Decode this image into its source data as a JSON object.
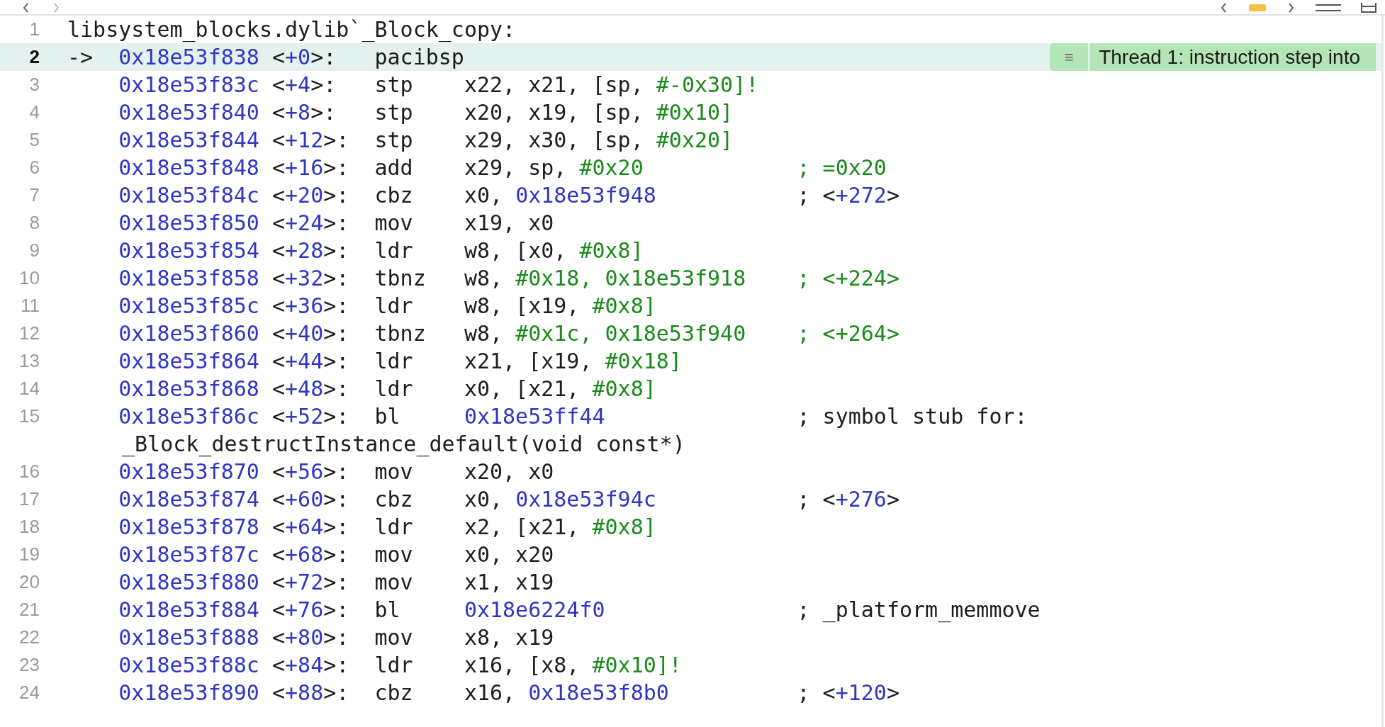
{
  "editor": {
    "rows": [
      {
        "number": "1",
        "kind": "label",
        "current": false,
        "label": "libsystem_blocks.dylib`_Block_copy:"
      },
      {
        "number": "2",
        "kind": "instruction",
        "current": true,
        "marker": "->",
        "address": "0x18e53f838",
        "offset": [
          {
            "text": "<",
            "kind": "plain"
          },
          {
            "text": "+0",
            "kind": "addr"
          },
          {
            "text": ">:",
            "kind": "plain"
          }
        ],
        "mnemonic": "pacibsp",
        "operands": [],
        "comment": [],
        "annotation": {
          "icon": "≡",
          "text": "Thread 1: instruction step into"
        }
      },
      {
        "number": "3",
        "kind": "instruction",
        "current": false,
        "address": "0x18e53f83c",
        "offset": [
          {
            "text": "<",
            "kind": "plain"
          },
          {
            "text": "+4",
            "kind": "addr"
          },
          {
            "text": ">:",
            "kind": "plain"
          }
        ],
        "mnemonic": "stp",
        "operands": [
          {
            "text": "x22, x21, [sp, ",
            "kind": "plain"
          },
          {
            "text": "#-0x30]!",
            "kind": "imm"
          }
        ],
        "comment": []
      },
      {
        "number": "4",
        "kind": "instruction",
        "current": false,
        "address": "0x18e53f840",
        "offset": [
          {
            "text": "<",
            "kind": "plain"
          },
          {
            "text": "+8",
            "kind": "addr"
          },
          {
            "text": ">:",
            "kind": "plain"
          }
        ],
        "mnemonic": "stp",
        "operands": [
          {
            "text": "x20, x19, [sp, ",
            "kind": "plain"
          },
          {
            "text": "#0x10]",
            "kind": "imm"
          }
        ],
        "comment": []
      },
      {
        "number": "5",
        "kind": "instruction",
        "current": false,
        "address": "0x18e53f844",
        "offset": [
          {
            "text": "<",
            "kind": "plain"
          },
          {
            "text": "+12",
            "kind": "addr"
          },
          {
            "text": ">:",
            "kind": "plain"
          }
        ],
        "mnemonic": "stp",
        "operands": [
          {
            "text": "x29, x30, [sp, ",
            "kind": "plain"
          },
          {
            "text": "#0x20]",
            "kind": "imm"
          }
        ],
        "comment": []
      },
      {
        "number": "6",
        "kind": "instruction",
        "current": false,
        "address": "0x18e53f848",
        "offset": [
          {
            "text": "<",
            "kind": "plain"
          },
          {
            "text": "+16",
            "kind": "addr"
          },
          {
            "text": ">:",
            "kind": "plain"
          }
        ],
        "mnemonic": "add",
        "operands": [
          {
            "text": "x29, sp, ",
            "kind": "plain"
          },
          {
            "text": "#0x20",
            "kind": "imm"
          }
        ],
        "comment": [
          {
            "text": "; =0x20",
            "kind": "imm"
          }
        ]
      },
      {
        "number": "7",
        "kind": "instruction",
        "current": false,
        "address": "0x18e53f84c",
        "offset": [
          {
            "text": "<",
            "kind": "plain"
          },
          {
            "text": "+20",
            "kind": "addr"
          },
          {
            "text": ">:",
            "kind": "plain"
          }
        ],
        "mnemonic": "cbz",
        "operands": [
          {
            "text": "x0, ",
            "kind": "plain"
          },
          {
            "text": "0x18e53f948",
            "kind": "addr"
          }
        ],
        "comment": [
          {
            "text": "; <",
            "kind": "plain"
          },
          {
            "text": "+272",
            "kind": "addr"
          },
          {
            "text": ">",
            "kind": "plain"
          }
        ]
      },
      {
        "number": "8",
        "kind": "instruction",
        "current": false,
        "address": "0x18e53f850",
        "offset": [
          {
            "text": "<",
            "kind": "plain"
          },
          {
            "text": "+24",
            "kind": "addr"
          },
          {
            "text": ">:",
            "kind": "plain"
          }
        ],
        "mnemonic": "mov",
        "operands": [
          {
            "text": "x19, x0",
            "kind": "plain"
          }
        ],
        "comment": []
      },
      {
        "number": "9",
        "kind": "instruction",
        "current": false,
        "address": "0x18e53f854",
        "offset": [
          {
            "text": "<",
            "kind": "plain"
          },
          {
            "text": "+28",
            "kind": "addr"
          },
          {
            "text": ">:",
            "kind": "plain"
          }
        ],
        "mnemonic": "ldr",
        "operands": [
          {
            "text": "w8, [x0, ",
            "kind": "plain"
          },
          {
            "text": "#0x8]",
            "kind": "imm"
          }
        ],
        "comment": []
      },
      {
        "number": "10",
        "kind": "instruction",
        "current": false,
        "address": "0x18e53f858",
        "offset": [
          {
            "text": "<",
            "kind": "plain"
          },
          {
            "text": "+32",
            "kind": "addr"
          },
          {
            "text": ">:",
            "kind": "plain"
          }
        ],
        "mnemonic": "tbnz",
        "operands": [
          {
            "text": "w8, ",
            "kind": "plain"
          },
          {
            "text": "#0x18, 0x18e53f918",
            "kind": "imm"
          }
        ],
        "comment": [
          {
            "text": "; <+224>",
            "kind": "imm"
          }
        ]
      },
      {
        "number": "11",
        "kind": "instruction",
        "current": false,
        "address": "0x18e53f85c",
        "offset": [
          {
            "text": "<",
            "kind": "plain"
          },
          {
            "text": "+36",
            "kind": "addr"
          },
          {
            "text": ">:",
            "kind": "plain"
          }
        ],
        "mnemonic": "ldr",
        "operands": [
          {
            "text": "w8, [x19, ",
            "kind": "plain"
          },
          {
            "text": "#0x8]",
            "kind": "imm"
          }
        ],
        "comment": []
      },
      {
        "number": "12",
        "kind": "instruction",
        "current": false,
        "address": "0x18e53f860",
        "offset": [
          {
            "text": "<",
            "kind": "plain"
          },
          {
            "text": "+40",
            "kind": "addr"
          },
          {
            "text": ">:",
            "kind": "plain"
          }
        ],
        "mnemonic": "tbnz",
        "operands": [
          {
            "text": "w8, ",
            "kind": "plain"
          },
          {
            "text": "#0x1c, 0x18e53f940",
            "kind": "imm"
          }
        ],
        "comment": [
          {
            "text": "; <+264>",
            "kind": "imm"
          }
        ]
      },
      {
        "number": "13",
        "kind": "instruction",
        "current": false,
        "address": "0x18e53f864",
        "offset": [
          {
            "text": "<",
            "kind": "plain"
          },
          {
            "text": "+44",
            "kind": "addr"
          },
          {
            "text": ">:",
            "kind": "plain"
          }
        ],
        "mnemonic": "ldr",
        "operands": [
          {
            "text": "x21, [x19, ",
            "kind": "plain"
          },
          {
            "text": "#0x18]",
            "kind": "imm"
          }
        ],
        "comment": []
      },
      {
        "number": "14",
        "kind": "instruction",
        "current": false,
        "address": "0x18e53f868",
        "offset": [
          {
            "text": "<",
            "kind": "plain"
          },
          {
            "text": "+48",
            "kind": "addr"
          },
          {
            "text": ">:",
            "kind": "plain"
          }
        ],
        "mnemonic": "ldr",
        "operands": [
          {
            "text": "x0, [x21, ",
            "kind": "plain"
          },
          {
            "text": "#0x8]",
            "kind": "imm"
          }
        ],
        "comment": []
      },
      {
        "number": "15",
        "kind": "instruction",
        "current": false,
        "address": "0x18e53f86c",
        "offset": [
          {
            "text": "<",
            "kind": "plain"
          },
          {
            "text": "+52",
            "kind": "addr"
          },
          {
            "text": ">:",
            "kind": "plain"
          }
        ],
        "mnemonic": "bl",
        "operands": [
          {
            "text": "0x18e53ff44",
            "kind": "addr"
          }
        ],
        "comment": [
          {
            "text": "; symbol stub for:",
            "kind": "plain"
          }
        ],
        "continuation": "_Block_destructInstance_default(void const*)"
      },
      {
        "number": "16",
        "kind": "instruction",
        "current": false,
        "address": "0x18e53f870",
        "offset": [
          {
            "text": "<",
            "kind": "plain"
          },
          {
            "text": "+56",
            "kind": "addr"
          },
          {
            "text": ">:",
            "kind": "plain"
          }
        ],
        "mnemonic": "mov",
        "operands": [
          {
            "text": "x20, x0",
            "kind": "plain"
          }
        ],
        "comment": []
      },
      {
        "number": "17",
        "kind": "instruction",
        "current": false,
        "address": "0x18e53f874",
        "offset": [
          {
            "text": "<",
            "kind": "plain"
          },
          {
            "text": "+60",
            "kind": "addr"
          },
          {
            "text": ">:",
            "kind": "plain"
          }
        ],
        "mnemonic": "cbz",
        "operands": [
          {
            "text": "x0, ",
            "kind": "plain"
          },
          {
            "text": "0x18e53f94c",
            "kind": "addr"
          }
        ],
        "comment": [
          {
            "text": "; <",
            "kind": "plain"
          },
          {
            "text": "+276",
            "kind": "addr"
          },
          {
            "text": ">",
            "kind": "plain"
          }
        ]
      },
      {
        "number": "18",
        "kind": "instruction",
        "current": false,
        "address": "0x18e53f878",
        "offset": [
          {
            "text": "<",
            "kind": "plain"
          },
          {
            "text": "+64",
            "kind": "addr"
          },
          {
            "text": ">:",
            "kind": "plain"
          }
        ],
        "mnemonic": "ldr",
        "operands": [
          {
            "text": "x2, [x21, ",
            "kind": "plain"
          },
          {
            "text": "#0x8]",
            "kind": "imm"
          }
        ],
        "comment": []
      },
      {
        "number": "19",
        "kind": "instruction",
        "current": false,
        "address": "0x18e53f87c",
        "offset": [
          {
            "text": "<",
            "kind": "plain"
          },
          {
            "text": "+68",
            "kind": "addr"
          },
          {
            "text": ">:",
            "kind": "plain"
          }
        ],
        "mnemonic": "mov",
        "operands": [
          {
            "text": "x0, x20",
            "kind": "plain"
          }
        ],
        "comment": []
      },
      {
        "number": "20",
        "kind": "instruction",
        "current": false,
        "address": "0x18e53f880",
        "offset": [
          {
            "text": "<",
            "kind": "plain"
          },
          {
            "text": "+72",
            "kind": "addr"
          },
          {
            "text": ">:",
            "kind": "plain"
          }
        ],
        "mnemonic": "mov",
        "operands": [
          {
            "text": "x1, x19",
            "kind": "plain"
          }
        ],
        "comment": []
      },
      {
        "number": "21",
        "kind": "instruction",
        "current": false,
        "address": "0x18e53f884",
        "offset": [
          {
            "text": "<",
            "kind": "plain"
          },
          {
            "text": "+76",
            "kind": "addr"
          },
          {
            "text": ">:",
            "kind": "plain"
          }
        ],
        "mnemonic": "bl",
        "operands": [
          {
            "text": "0x18e6224f0",
            "kind": "addr"
          }
        ],
        "comment": [
          {
            "text": "; _platform_memmove",
            "kind": "plain"
          }
        ]
      },
      {
        "number": "22",
        "kind": "instruction",
        "current": false,
        "address": "0x18e53f888",
        "offset": [
          {
            "text": "<",
            "kind": "plain"
          },
          {
            "text": "+80",
            "kind": "addr"
          },
          {
            "text": ">:",
            "kind": "plain"
          }
        ],
        "mnemonic": "mov",
        "operands": [
          {
            "text": "x8, x19",
            "kind": "plain"
          }
        ],
        "comment": []
      },
      {
        "number": "23",
        "kind": "instruction",
        "current": false,
        "address": "0x18e53f88c",
        "offset": [
          {
            "text": "<",
            "kind": "plain"
          },
          {
            "text": "+84",
            "kind": "addr"
          },
          {
            "text": ">:",
            "kind": "plain"
          }
        ],
        "mnemonic": "ldr",
        "operands": [
          {
            "text": "x16, [x8, ",
            "kind": "plain"
          },
          {
            "text": "#0x10]!",
            "kind": "imm"
          }
        ],
        "comment": []
      },
      {
        "number": "24",
        "kind": "instruction",
        "current": false,
        "address": "0x18e53f890",
        "offset": [
          {
            "text": "<",
            "kind": "plain"
          },
          {
            "text": "+88",
            "kind": "addr"
          },
          {
            "text": ">:",
            "kind": "plain"
          }
        ],
        "mnemonic": "cbz",
        "operands": [
          {
            "text": "x16, ",
            "kind": "plain"
          },
          {
            "text": "0x18e53f8b0",
            "kind": "addr"
          }
        ],
        "comment": [
          {
            "text": "; <",
            "kind": "plain"
          },
          {
            "text": "+120",
            "kind": "addr"
          },
          {
            "text": ">",
            "kind": "plain"
          }
        ]
      }
    ]
  }
}
